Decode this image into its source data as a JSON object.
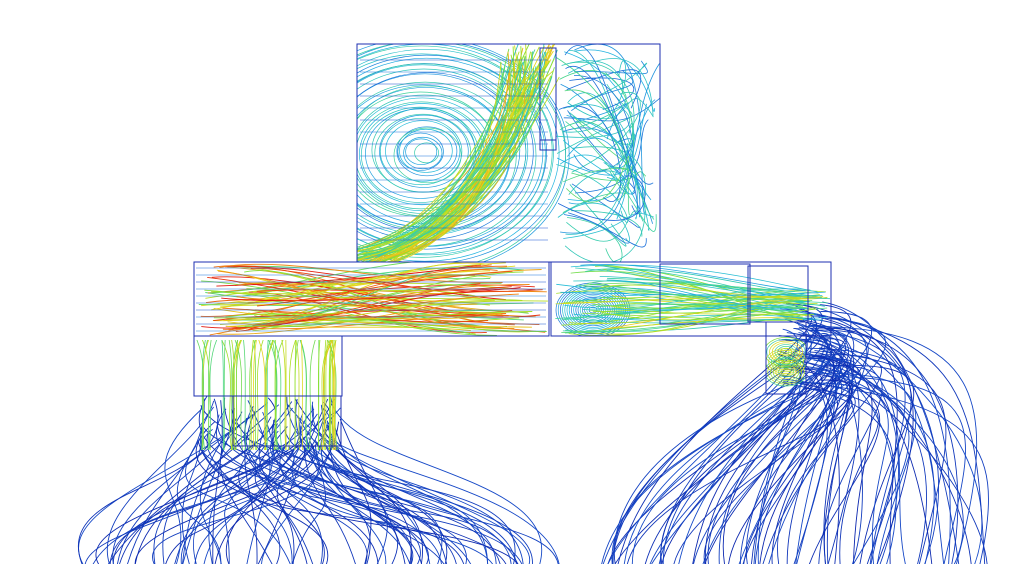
{
  "image": {
    "subject": "cfd-streamline-plot",
    "background_color": "#ffffff",
    "outline_color": "#1c2fb0",
    "colormap": [
      "#0a1fa8",
      "#1c5fd8",
      "#22b8e0",
      "#3fd39a",
      "#8ee12a",
      "#e6d81c",
      "#f07a12",
      "#e01010"
    ]
  }
}
